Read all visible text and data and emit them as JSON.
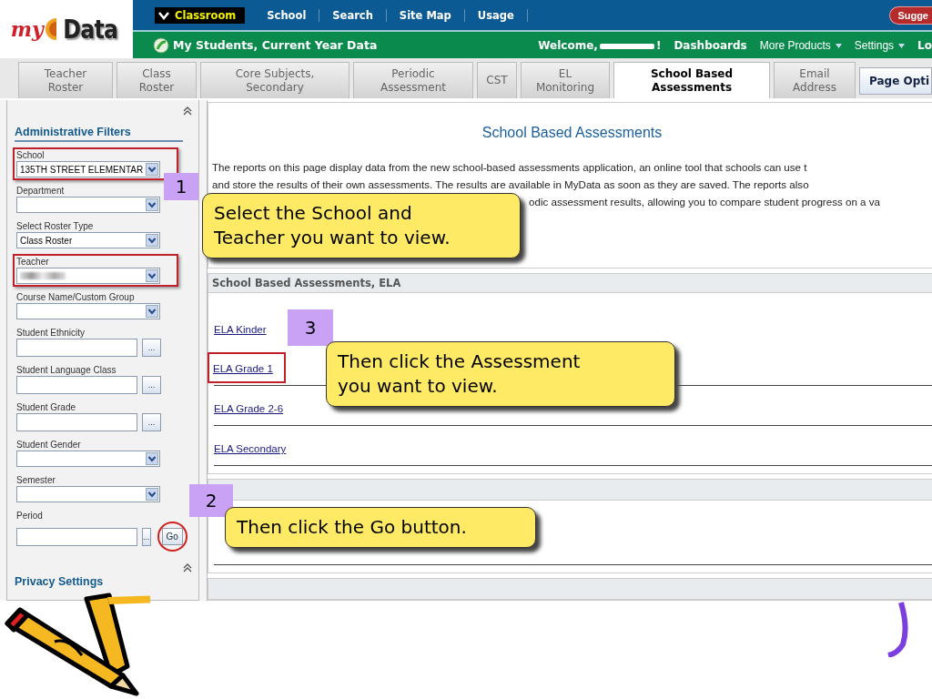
{
  "logo": {
    "prefix": "my",
    "name": "Data"
  },
  "top_nav": {
    "items": [
      {
        "label": "Classroom",
        "selected": true
      },
      {
        "label": "School",
        "selected": false
      },
      {
        "label": "Search",
        "selected": false
      },
      {
        "label": "Site Map",
        "selected": false
      },
      {
        "label": "Usage",
        "selected": false
      }
    ],
    "suggest_button": "Sugge"
  },
  "sub_bar": {
    "title": "My Students, Current Year Data",
    "welcome": "Welcome,",
    "welcome_end": "!",
    "links": [
      {
        "label": "Dashboards",
        "kind": "link"
      },
      {
        "label": "More Products",
        "kind": "menu"
      },
      {
        "label": "Settings",
        "kind": "menu"
      },
      {
        "label": "Lo",
        "kind": "link"
      }
    ]
  },
  "tabs": [
    {
      "label": "Teacher Roster",
      "selected": false
    },
    {
      "label": "Class Roster",
      "selected": false
    },
    {
      "label": "Core Subjects, Secondary",
      "selected": false
    },
    {
      "label": "Periodic Assessment",
      "selected": false
    },
    {
      "label": "CST",
      "selected": false
    },
    {
      "label": "EL Monitoring",
      "selected": false
    },
    {
      "label": "School Based Assessments",
      "selected": true
    },
    {
      "label": "Email Address",
      "selected": false
    }
  ],
  "page_options": "Page Opti",
  "sidebar": {
    "title": "Administrative Filters",
    "fields": [
      {
        "label": "School",
        "kind": "select",
        "value": "135TH STREET ELEMENTAR",
        "highlighted": true
      },
      {
        "label": "Department",
        "kind": "select",
        "highlighted": false
      },
      {
        "label": "Select Roster Type",
        "kind": "select",
        "value": "Class Roster",
        "highlighted": false
      },
      {
        "label": "Teacher",
        "kind": "select",
        "redacted": true,
        "highlighted": true
      },
      {
        "label": "Course Name/Custom Group",
        "kind": "select",
        "highlighted": false
      },
      {
        "label": "Student Ethnicity",
        "kind": "picker",
        "button": "...",
        "highlighted": false
      },
      {
        "label": "Student Language Class",
        "kind": "picker",
        "button": "...",
        "highlighted": false
      },
      {
        "label": "Student Grade",
        "kind": "picker",
        "button": "...",
        "highlighted": false
      },
      {
        "label": "Student Gender",
        "kind": "select",
        "highlighted": false
      },
      {
        "label": "Semester",
        "kind": "select",
        "highlighted": false
      },
      {
        "label": "Period",
        "kind": "picker",
        "button": "...",
        "go": "Go",
        "go_circled": true,
        "highlighted": false
      }
    ],
    "privacy_title": "Privacy Settings"
  },
  "main": {
    "title": "School Based Assessments",
    "intro_lines": [
      "The reports on this page display data from the new school-based assessments application, an online tool that schools can use t",
      "and store the results of their own assessments. The results are available in MyData as soon as they are saved. The reports also",
      "odic assessment results, allowing you to compare student progress on a va"
    ],
    "sections": [
      {
        "title": "School Based Assessments, ELA",
        "links": [
          {
            "label": "ELA Kinder",
            "highlighted": false
          },
          {
            "label": "ELA Grade 1",
            "highlighted": true
          },
          {
            "label": "ELA Grade 2-6",
            "highlighted": false
          },
          {
            "label": "ELA Secondary",
            "highlighted": false
          }
        ]
      },
      {
        "kind": "blank"
      },
      {
        "kind": "cut"
      }
    ]
  },
  "callouts": [
    {
      "number": "1",
      "text": "Select the School and Teacher you want to view."
    },
    {
      "number": "2",
      "text": "Then click the Go button."
    },
    {
      "number": "3",
      "text": "Then click the Assessment you want to view."
    }
  ]
}
